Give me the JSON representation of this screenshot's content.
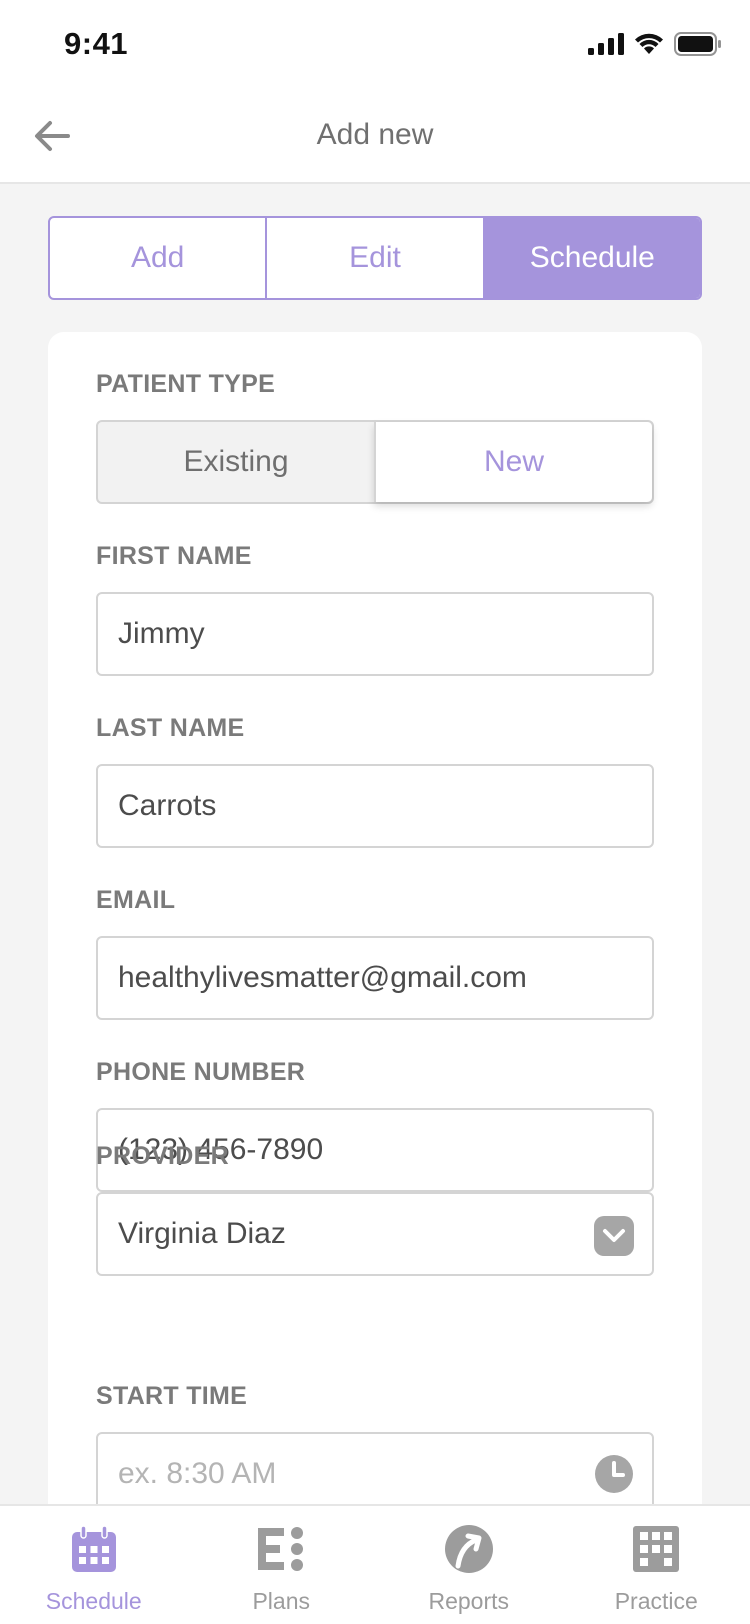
{
  "status_bar": {
    "time": "9:41"
  },
  "header": {
    "title": "Add new"
  },
  "mode_tabs": [
    {
      "label": "Add",
      "active": false
    },
    {
      "label": "Edit",
      "active": false
    },
    {
      "label": "Schedule",
      "active": true
    }
  ],
  "form": {
    "patient_type": {
      "label": "PATIENT TYPE",
      "options": [
        "Existing",
        "New"
      ],
      "selected": "New"
    },
    "first_name": {
      "label": "FIRST NAME",
      "value": "Jimmy"
    },
    "last_name": {
      "label": "LAST NAME",
      "value": "Carrots"
    },
    "email": {
      "label": "EMAIL",
      "value": "healthylivesmatter@gmail.com"
    },
    "phone": {
      "label": "PHONE NUMBER",
      "value": "(123) 456-7890"
    },
    "provider": {
      "label": "PROVIDER",
      "value": "Virginia Diaz"
    },
    "start_time": {
      "label": "START TIME",
      "placeholder": "ex. 8:30 AM"
    }
  },
  "bottom_nav": [
    {
      "label": "Schedule",
      "icon": "calendar-icon",
      "active": true
    },
    {
      "label": "Plans",
      "icon": "plans-icon",
      "active": false
    },
    {
      "label": "Reports",
      "icon": "reports-icon",
      "active": false
    },
    {
      "label": "Practice",
      "icon": "building-icon",
      "active": false
    }
  ],
  "colors": {
    "accent": "#a594dc",
    "background": "#f4f4f4",
    "border": "#d4d4d4"
  }
}
